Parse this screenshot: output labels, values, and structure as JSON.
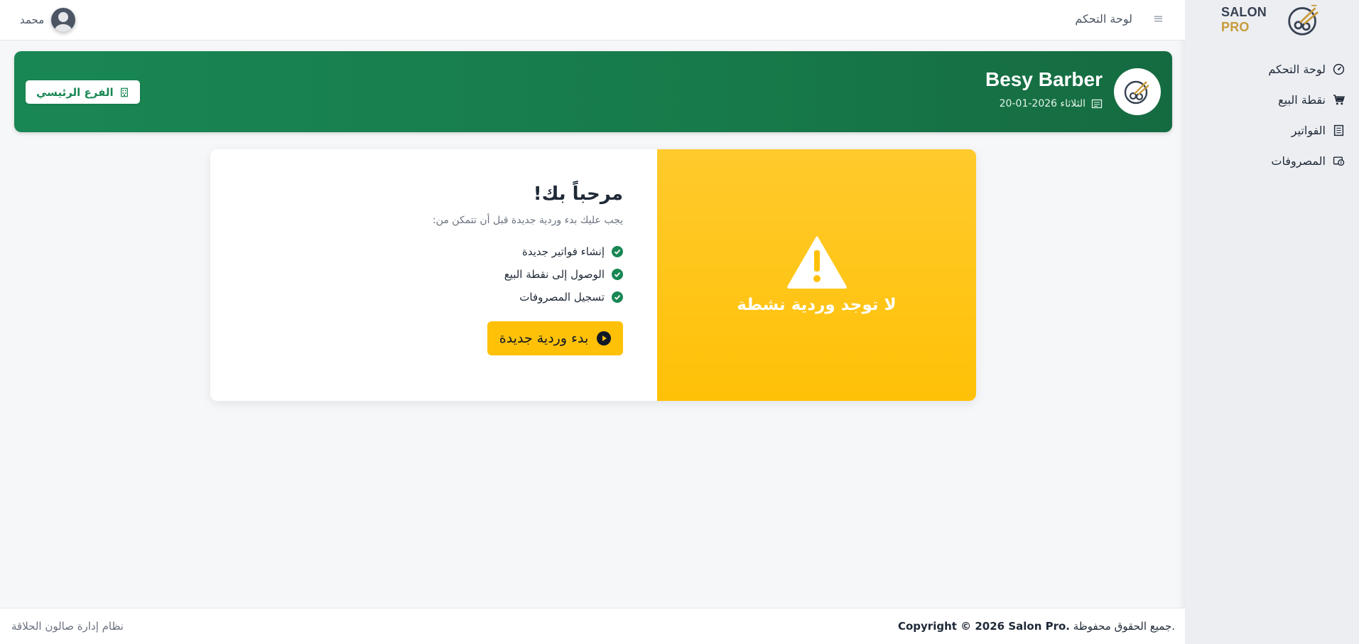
{
  "sidebar": {
    "logo": {
      "salon": "SALON",
      "pro": "PRO"
    },
    "items": [
      {
        "label": "لوحة التحكم",
        "icon": "dashboard-icon"
      },
      {
        "label": "نقطة البيع",
        "icon": "cart-icon"
      },
      {
        "label": "الفواتير",
        "icon": "invoice-icon"
      },
      {
        "label": "المصروفات",
        "icon": "expenses-icon"
      }
    ]
  },
  "topbar": {
    "title": "لوحة التحكم",
    "menu_icon": "menu-icon",
    "user_name": "محمد"
  },
  "banner": {
    "name": "Besy Barber",
    "date": "الثلاثاء 2026-01-20",
    "branch_label": "الفرع الرئيسي",
    "colors": {
      "start": "#198754",
      "end": "#156b41"
    }
  },
  "shift": {
    "warning_text": "لا توجد وردية نشطة",
    "welcome": "مرحباً بك!",
    "subtitle": "يجب عليك بدء وردية جديدة قبل أن تتمكن من:",
    "features": [
      "إنشاء فواتير جديدة",
      "الوصول إلى نقطة البيع",
      "تسجيل المصروفات"
    ],
    "start_label": "بدء وردية جديدة",
    "colors": {
      "warning": "#ffc107",
      "check": "#198754"
    }
  },
  "footer": {
    "copyright_prefix": "Copyright © 2026 Salon Pro.",
    "copyright_suffix": "جميع الحقوق محفوظة.",
    "system_name": "نظام إدارة صالون الحلاقة"
  }
}
